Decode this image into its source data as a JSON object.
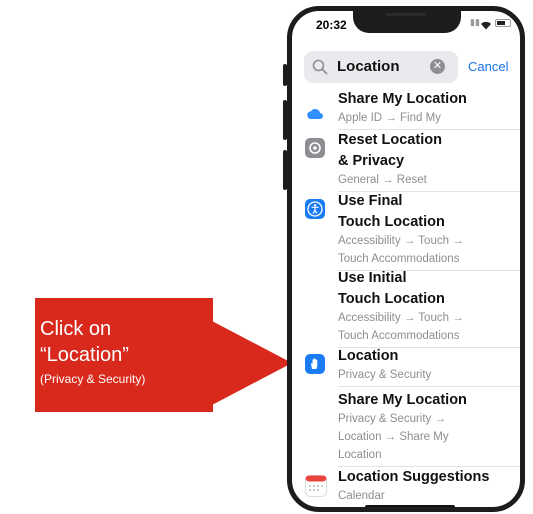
{
  "status_bar": {
    "time": "20:32"
  },
  "search": {
    "query": "Location",
    "cancel_label": "Cancel"
  },
  "results": [
    {
      "title_lines": [
        "Share My Location"
      ],
      "sub_lines": [
        "Apple ID → Find My"
      ],
      "icon": "cloud-icon",
      "color": "#2f8fff"
    },
    {
      "title_lines": [
        "Reset Location",
        "& Privacy"
      ],
      "sub_lines": [
        "General → Reset"
      ],
      "icon": "gear-icon",
      "color": "#8e8e93"
    },
    {
      "title_lines": [
        "Use Final",
        "Touch Location"
      ],
      "sub_lines": [
        "Accessibility → Touch →",
        "Touch Accommodations"
      ],
      "icon": "accessibility-icon",
      "color": "#1a7cf5"
    },
    {
      "title_lines": [
        "Use Initial",
        "Touch Location"
      ],
      "sub_lines": [
        "Accessibility → Touch →",
        "Touch Accommodations"
      ],
      "icon": "",
      "color": ""
    },
    {
      "title_lines": [
        "Location"
      ],
      "sub_lines": [
        "Privacy & Security"
      ],
      "icon": "hand-icon",
      "color": "#1a7cf5"
    },
    {
      "title_lines": [
        "Share My Location"
      ],
      "sub_lines": [
        "Privacy & Security →",
        "Location → Share My",
        "Location"
      ],
      "icon": "",
      "color": ""
    },
    {
      "title_lines": [
        "Location Suggestions"
      ],
      "sub_lines": [
        "Calendar"
      ],
      "icon": "calendar-icon",
      "color": "#ffffff"
    }
  ],
  "callout": {
    "line1": "Click on",
    "line2": "“Location”",
    "line3": "(Privacy & Security)",
    "color": "#d9291c"
  }
}
